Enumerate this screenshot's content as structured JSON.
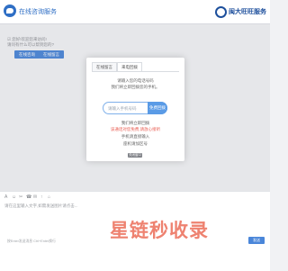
{
  "header": {
    "title": "在线咨询服务",
    "brand_name": "闽大旺旺服务"
  },
  "chat": {
    "system_lines": [
      "☑ 您好!欢迎您来访问!",
      "请问有什么可以帮到您的?"
    ],
    "quick_buttons": [
      "在线咨询",
      "在线留言"
    ]
  },
  "modal": {
    "tabs": [
      "在线留言",
      "来电回拨"
    ],
    "active_tab": 1,
    "intro_lines": [
      "请输入您的电话号码",
      "我们将立即回拨您的手机。"
    ],
    "phone_placeholder": "请输入手机号码",
    "callback_label": "免费回拨",
    "status_lines": [
      "我们将立即回拨",
      "该通话对您免费,请放心接听",
      "手机请直接输入",
      "座机请加区号"
    ],
    "close_label": "关闭窗口"
  },
  "toolbar": {
    "tools": [
      "A",
      "☺",
      "✂",
      "☎",
      "✉",
      "↑",
      "⌂"
    ]
  },
  "input": {
    "placeholder": "请在这里输入文字,如需发送图片请点击...",
    "footer": "按Enter发送消息 Ctrl+Enter换行",
    "send_label": "发送"
  },
  "watermark": {
    "text": "星链秒收录"
  },
  "colors": {
    "accent": "#4a86d9",
    "brand": "#1d4f9c",
    "red_text": "#e85a4f",
    "watermark": "#e85840"
  }
}
